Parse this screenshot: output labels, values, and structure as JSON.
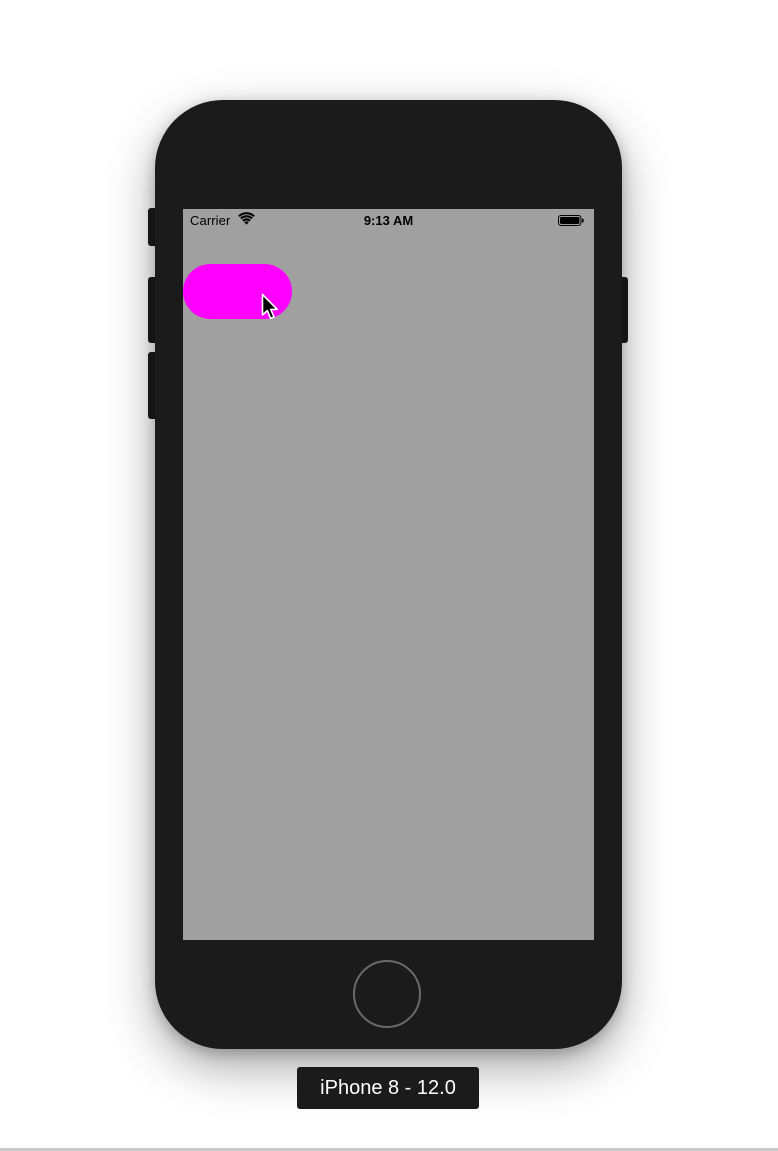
{
  "status_bar": {
    "carrier": "Carrier",
    "time": "9:13 AM",
    "wifi_icon": "wifi-icon",
    "battery_icon": "battery-icon"
  },
  "app": {
    "background_color": "#a0a0a0",
    "pill_button": {
      "color": "#ff00ff",
      "label": ""
    }
  },
  "device": {
    "label": "iPhone 8 - 12.0",
    "body_color": "#1b1b1b",
    "home_button_icon": "home-button-ring"
  },
  "cursor_icon": "arrow-pointer-icon"
}
